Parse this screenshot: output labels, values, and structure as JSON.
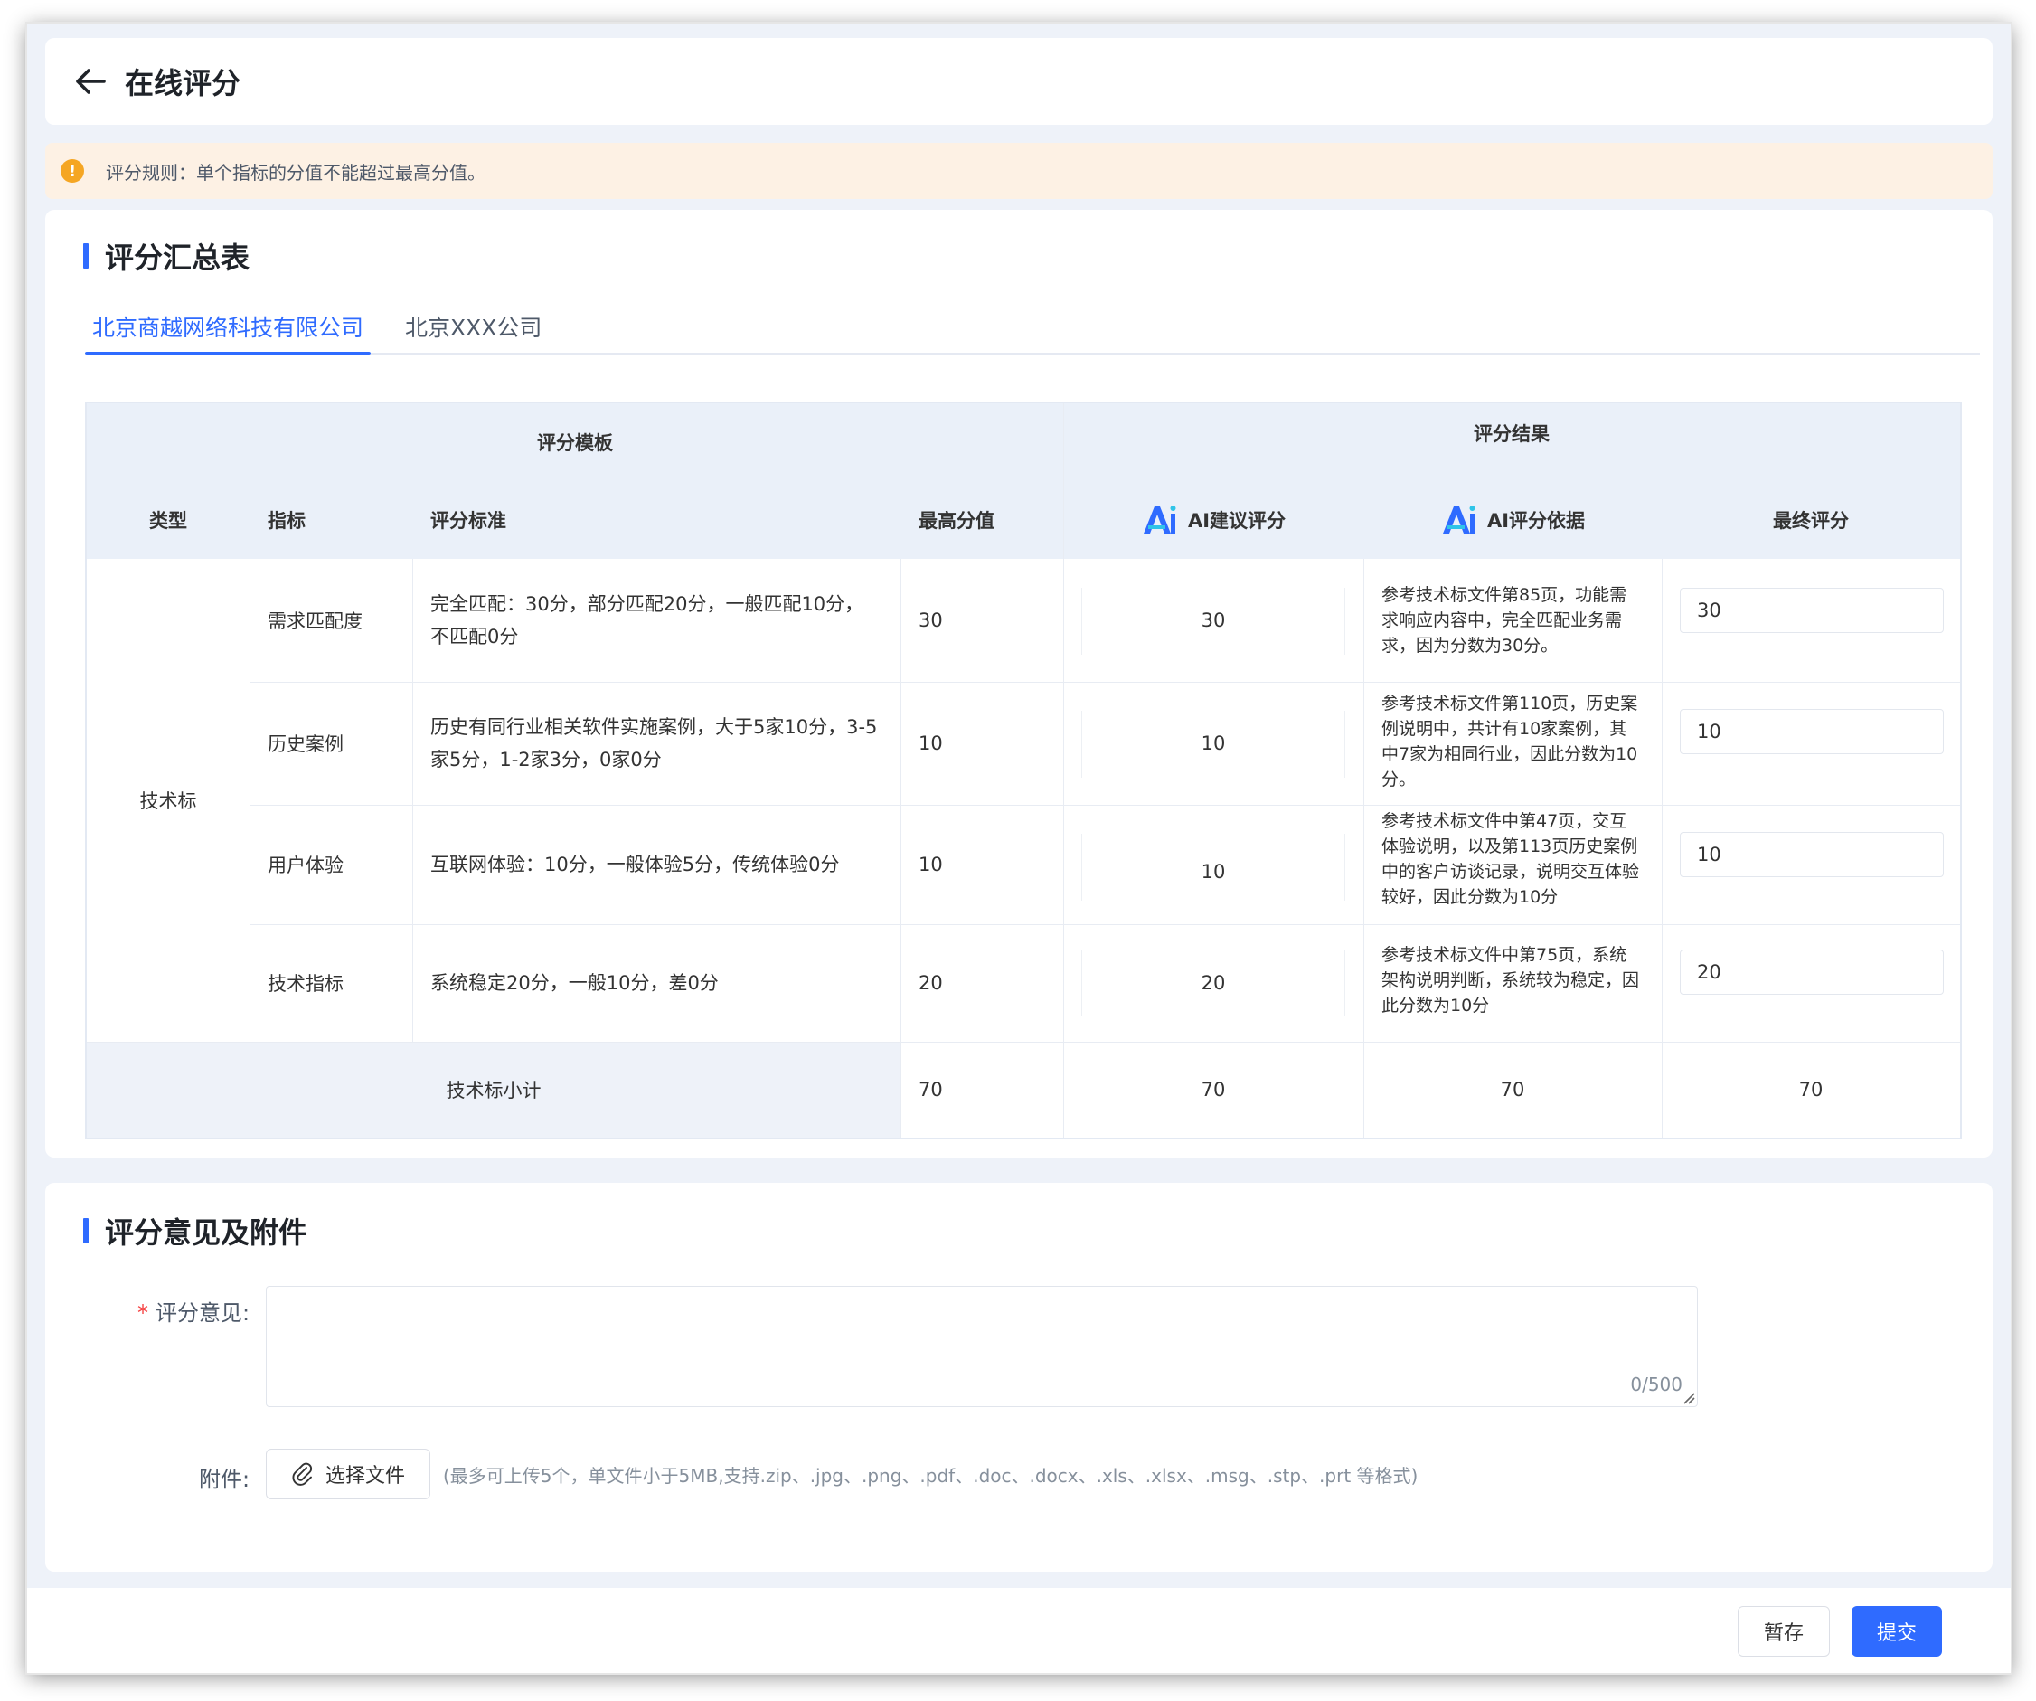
{
  "header": {
    "title": "在线评分"
  },
  "alert": {
    "text": "评分规则：单个指标的分值不能超过最高分值。"
  },
  "summary": {
    "title": "评分汇总表",
    "tabs": [
      {
        "label": "北京商越网络科技有限公司",
        "active": true
      },
      {
        "label": "北京XXX公司",
        "active": false
      }
    ],
    "table": {
      "group_template": "评分模板",
      "group_result": "评分结果",
      "columns": {
        "type": "类型",
        "indicator": "指标",
        "standard": "评分标准",
        "max": "最高分值",
        "ai_score": "AI建议评分",
        "ai_basis": "AI评分依据",
        "final": "最终评分"
      },
      "type_value": "技术标",
      "rows": [
        {
          "indicator": "需求匹配度",
          "standard": "完全匹配：30分，部分匹配20分，一般匹配10分，不匹配0分",
          "max": "30",
          "ai_score": "30",
          "basis": "参考技术标文件第85页，功能需求响应内容中，完全匹配业务需求，因为分数为30分。",
          "final": "30"
        },
        {
          "indicator": "历史案例",
          "standard": "历史有同行业相关软件实施案例，大于5家10分，3-5家5分，1-2家3分，0家0分",
          "max": "10",
          "ai_score": "10",
          "basis": "参考技术标文件第110页，历史案例说明中，共计有10家案例，其中7家为相同行业，因此分数为10分。",
          "final": "10"
        },
        {
          "indicator": "用户体验",
          "standard": "互联网体验：10分，一般体验5分，传统体验0分",
          "max": "10",
          "ai_score": "10",
          "basis": "参考技术标文件中第47页，交互体验说明，以及第113页历史案例中的客户访谈记录，说明交互体验较好，因此分数为10分",
          "final": "10"
        },
        {
          "indicator": "技术指标",
          "standard": "系统稳定20分，一般10分，差0分",
          "max": "20",
          "ai_score": "20",
          "basis": "参考技术标文件中第75页，系统架构说明判断，系统较为稳定，因此分数为10分",
          "final": "20"
        }
      ],
      "subtotal": {
        "label": "技术标小计",
        "max": "70",
        "ai_score": "70",
        "basis": "70",
        "final": "70"
      }
    }
  },
  "opinion": {
    "title": "评分意见及附件",
    "comment_label": "评分意见:",
    "required_mark": "*",
    "counter": "0/500",
    "attachment_label": "附件:",
    "choose_file": "选择文件",
    "file_hint": "(最多可上传5个，单文件小于5MB,支持.zip、.jpg、.png、.pdf、.doc、.docx、.xls、.xlsx、.msg、.stp、.prt 等格式)"
  },
  "footer": {
    "save": "暂存",
    "submit": "提交"
  },
  "colors": {
    "primary": "#2f6bff",
    "warning": "#f5a623",
    "required": "#f53f3f"
  }
}
